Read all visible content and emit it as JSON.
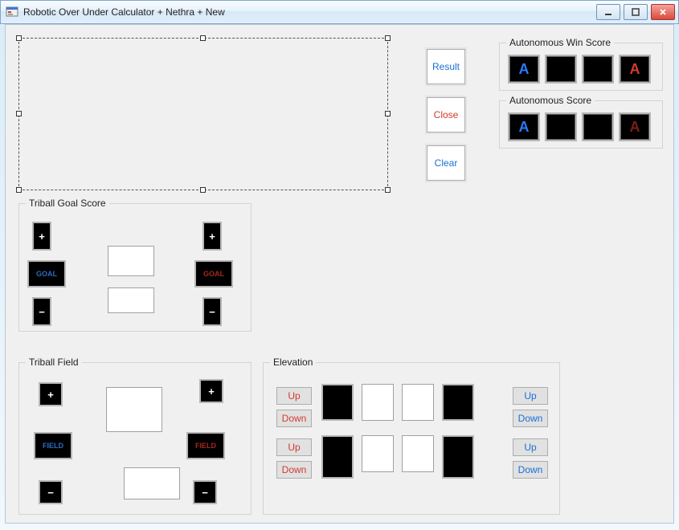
{
  "window": {
    "title": "Robotic Over Under Calculator + Nethra + New"
  },
  "buttons": {
    "result": "Result",
    "close": "Close",
    "clear": "Clear"
  },
  "autonomous_win": {
    "title": "Autonomous Win Score",
    "tile_blue": "A",
    "tile_red": "A"
  },
  "autonomous_score": {
    "title": "Autonomous Score",
    "tile_blue": "A",
    "tile_red": "A"
  },
  "triball_goal": {
    "title": "Triball Goal Score",
    "label_blue": "GOAL",
    "label_red": "GOAL",
    "value1": "",
    "value2": ""
  },
  "triball_field": {
    "title": "Triball Field",
    "label_blue": "FIELD",
    "label_red": "FIELD",
    "value1": "",
    "value2": ""
  },
  "elevation": {
    "title": "Elevation",
    "up": "Up",
    "down": "Down",
    "value1": "",
    "value2": "",
    "value3": "",
    "value4": ""
  }
}
